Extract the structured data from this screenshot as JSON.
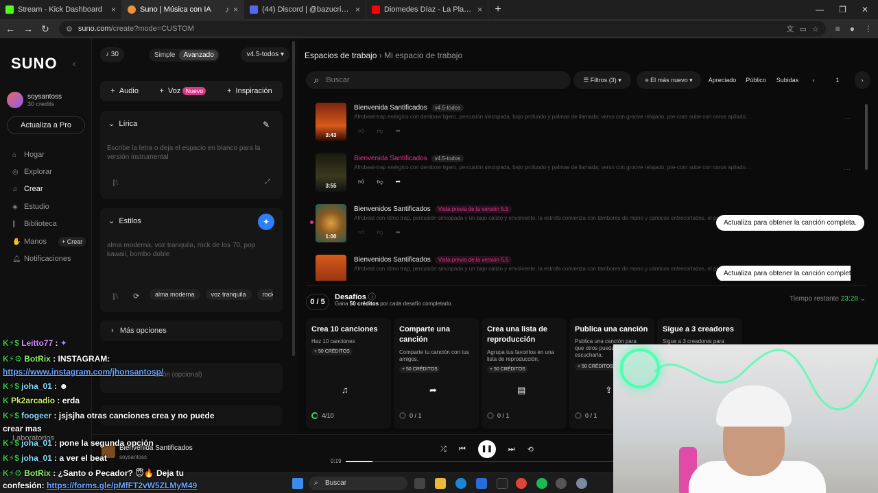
{
  "browser": {
    "tabs": [
      {
        "title": "Stream - Kick Dashboard",
        "color": "#53fc18"
      },
      {
        "title": "Suno | Música con IA",
        "color": "#f0913a"
      },
      {
        "title": "(44) Discord | @bazucristo1",
        "color": "#5865f2"
      },
      {
        "title": "Diomedes Díaz - La Plata (En Vi",
        "color": "#ff0000"
      }
    ],
    "url_host": "suno.com",
    "url_path": "/create?mode=CUSTOM"
  },
  "sidebar": {
    "logo": "SUNO",
    "user_name": "soysantoss",
    "user_credits": "30 credits",
    "upgrade": "Actualiza a Pro",
    "items": [
      {
        "label": "Hogar",
        "icon": "home-icon"
      },
      {
        "label": "Explorar",
        "icon": "compass-icon"
      },
      {
        "label": "Crear",
        "icon": "music-icon"
      },
      {
        "label": "Estudio",
        "icon": "studio-icon"
      },
      {
        "label": "Biblioteca",
        "icon": "library-icon"
      },
      {
        "label": "Manos",
        "icon": "hands-icon"
      },
      {
        "label": "Notificaciones",
        "icon": "bell-icon"
      }
    ],
    "crear_badge": "+ Crear",
    "lab": "Laboratorios"
  },
  "create": {
    "credits": "30",
    "mode_simple": "Simple",
    "mode_advanced": "Avanzado",
    "model": "v4.5-todos",
    "add_audio": "Audio",
    "add_voice": "Voz",
    "new_badge": "Nuevo",
    "add_inspiration": "Inspiración",
    "lyrics_title": "Lírica",
    "lyrics_placeholder": "Escribe la letra o deja el espacio en blanco para la versión instrumental",
    "styles_title": "Estilos",
    "styles_value": "alma moderna, voz tranquila, rock de los 70, pop kawaii, bombo doble",
    "style_chips": [
      "alma moderna",
      "voz tranquila",
      "rock d"
    ],
    "more_options": "Más opciones",
    "title_placeholder": "ación (opcional)"
  },
  "workspace": {
    "crumb_root": "Espacios de trabajo",
    "crumb_current": "Mi espacio de trabajo",
    "search_placeholder": "Buscar",
    "filters": "Filtros",
    "filters_count": "(3)",
    "sort": "El más nuevo",
    "liked": "Apreciado",
    "public": "Público",
    "uploads": "Subidas",
    "page": "1",
    "songs": [
      {
        "title": "Bienvenida Santificados",
        "tag": "v4.5-todos",
        "tag_style": "normal",
        "desc": "Afrobeat-trap enérgico con dembow ligero, percusión sincopada, bajo profundo y palmas de llamada; verso con groove relajado, pre-coro sube con coros apilados y filtros...",
        "duration": "3:43",
        "pink_title": false,
        "cta": ""
      },
      {
        "title": "Bienvenida Santificados",
        "tag": "v4.5-todos",
        "tag_style": "normal",
        "desc": "Afrobeat-trap enérgico con dembow ligero, percusión sincopada, bajo profundo y palmas de llamada; verso con groove relajado, pre-coro sube con coros apilados y filtros...",
        "duration": "3:55",
        "pink_title": true,
        "cta": ""
      },
      {
        "title": "Bienvenidos Santificados",
        "tag": "Vista previa de la versión 5.5",
        "tag_style": "pink",
        "desc": "Afrobeat con ritmo trap, percusión sincopada y un bajo cálido y envolvente, la estrofa comienza con tambores de mano y cánticos entrecortados, el pre-es...",
        "duration": "1:00",
        "pink_title": false,
        "cta": "Actualiza para obtener la canción completa."
      },
      {
        "title": "Bienvenidos Santificados",
        "tag": "Vista previa de la versión 5.5",
        "tag_style": "pink",
        "desc": "Afrobeat con ritmo trap, percusión sincopada y un bajo cálido y envolvente, la estrofa comienza con tambores de mano y cánticos entrecortados, el pre-es...",
        "duration": "",
        "pink_title": false,
        "cta": "Actualiza para obtener la canción completa."
      }
    ],
    "challenges": {
      "count": "0 / 5",
      "title": "Desafíos",
      "sub_pre": "Gana ",
      "sub_bold": "50 créditos",
      "sub_post": " por cada desafío completado.",
      "time_label": "Tiempo restante ",
      "time": "23:28",
      "items": [
        {
          "title": "Crea 10 canciones",
          "desc": "Haz 10 canciones",
          "credits": "+ 50 CRÉDITOS",
          "icon": "music-note-icon",
          "progress": "4/10",
          "progress_fraction": 0.4
        },
        {
          "title": "Comparte una canción",
          "desc": "Comparte tu canción con tus amigos.",
          "credits": "+ 50 CRÉDITOS",
          "icon": "share-icon",
          "progress": "0 / 1",
          "progress_fraction": 0
        },
        {
          "title": "Crea una lista de reproducción",
          "desc": "Agrupa tus favoritos en una lista de reproducción.",
          "credits": "+ 50 CRÉDITOS",
          "icon": "playlist-icon",
          "progress": "0 / 1",
          "progress_fraction": 0
        },
        {
          "title": "Publica una canción",
          "desc": "Publica una canción para que otros puedan escucharla.",
          "credits": "+ 50 CRÉDITOS",
          "icon": "upload-icon",
          "progress": "0 / 1",
          "progress_fraction": 0
        },
        {
          "title": "Sigue a 3 creadores",
          "desc": "Sigue a 3 creadores para",
          "credits": "",
          "icon": "",
          "progress": "",
          "progress_fraction": 0
        }
      ]
    }
  },
  "player": {
    "title": "Bienvenida Santificados",
    "artist": "soysantoss",
    "time": "0:19",
    "progress_fraction": 0.1
  },
  "taskbar": {
    "search": "Buscar"
  },
  "chat": [
    {
      "user": "Leitto77",
      "msg": " : "
    },
    {
      "user": "BotRix",
      "msg": " : INSTAGRAM:"
    },
    {
      "link": "https://www.instagram.com/jhonsantosp/"
    },
    {
      "user": "joha_01",
      "msg": " : "
    },
    {
      "user": "Pk2arcadio",
      "msg": " : erda"
    },
    {
      "user": "foogeer",
      "msg": " : jsjsjha otras canciones crea y no puede"
    },
    {
      "text": "crear mas"
    },
    {
      "user": "joha_01",
      "msg": " : pone la segunda opción"
    },
    {
      "user": "joha_01",
      "msg": " : a ver el beat"
    },
    {
      "user": "BotRix",
      "msg": " : ¿Santo o Pecador? 😇🔥 Deja tu"
    },
    {
      "text": "confesión: ",
      "link": "https://forms.gle/pMfFT2vW5ZLMyM49"
    }
  ]
}
